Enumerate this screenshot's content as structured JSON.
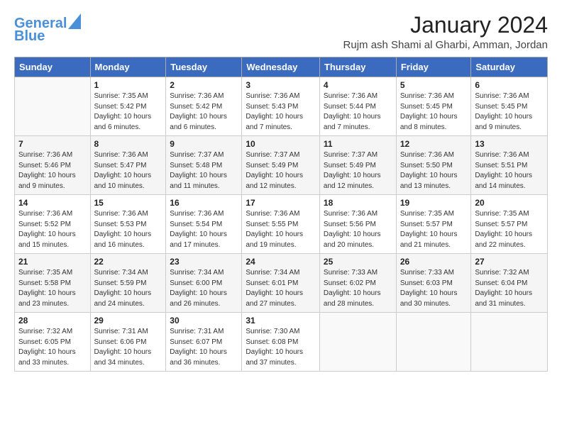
{
  "logo": {
    "line1": "General",
    "line2": "Blue"
  },
  "title": "January 2024",
  "location": "Rujm ash Shami al Gharbi, Amman, Jordan",
  "days_of_week": [
    "Sunday",
    "Monday",
    "Tuesday",
    "Wednesday",
    "Thursday",
    "Friday",
    "Saturday"
  ],
  "weeks": [
    [
      {
        "num": "",
        "info": ""
      },
      {
        "num": "1",
        "info": "Sunrise: 7:35 AM\nSunset: 5:42 PM\nDaylight: 10 hours\nand 6 minutes."
      },
      {
        "num": "2",
        "info": "Sunrise: 7:36 AM\nSunset: 5:42 PM\nDaylight: 10 hours\nand 6 minutes."
      },
      {
        "num": "3",
        "info": "Sunrise: 7:36 AM\nSunset: 5:43 PM\nDaylight: 10 hours\nand 7 minutes."
      },
      {
        "num": "4",
        "info": "Sunrise: 7:36 AM\nSunset: 5:44 PM\nDaylight: 10 hours\nand 7 minutes."
      },
      {
        "num": "5",
        "info": "Sunrise: 7:36 AM\nSunset: 5:45 PM\nDaylight: 10 hours\nand 8 minutes."
      },
      {
        "num": "6",
        "info": "Sunrise: 7:36 AM\nSunset: 5:45 PM\nDaylight: 10 hours\nand 9 minutes."
      }
    ],
    [
      {
        "num": "7",
        "info": "Sunrise: 7:36 AM\nSunset: 5:46 PM\nDaylight: 10 hours\nand 9 minutes."
      },
      {
        "num": "8",
        "info": "Sunrise: 7:36 AM\nSunset: 5:47 PM\nDaylight: 10 hours\nand 10 minutes."
      },
      {
        "num": "9",
        "info": "Sunrise: 7:37 AM\nSunset: 5:48 PM\nDaylight: 10 hours\nand 11 minutes."
      },
      {
        "num": "10",
        "info": "Sunrise: 7:37 AM\nSunset: 5:49 PM\nDaylight: 10 hours\nand 12 minutes."
      },
      {
        "num": "11",
        "info": "Sunrise: 7:37 AM\nSunset: 5:49 PM\nDaylight: 10 hours\nand 12 minutes."
      },
      {
        "num": "12",
        "info": "Sunrise: 7:36 AM\nSunset: 5:50 PM\nDaylight: 10 hours\nand 13 minutes."
      },
      {
        "num": "13",
        "info": "Sunrise: 7:36 AM\nSunset: 5:51 PM\nDaylight: 10 hours\nand 14 minutes."
      }
    ],
    [
      {
        "num": "14",
        "info": "Sunrise: 7:36 AM\nSunset: 5:52 PM\nDaylight: 10 hours\nand 15 minutes."
      },
      {
        "num": "15",
        "info": "Sunrise: 7:36 AM\nSunset: 5:53 PM\nDaylight: 10 hours\nand 16 minutes."
      },
      {
        "num": "16",
        "info": "Sunrise: 7:36 AM\nSunset: 5:54 PM\nDaylight: 10 hours\nand 17 minutes."
      },
      {
        "num": "17",
        "info": "Sunrise: 7:36 AM\nSunset: 5:55 PM\nDaylight: 10 hours\nand 19 minutes."
      },
      {
        "num": "18",
        "info": "Sunrise: 7:36 AM\nSunset: 5:56 PM\nDaylight: 10 hours\nand 20 minutes."
      },
      {
        "num": "19",
        "info": "Sunrise: 7:35 AM\nSunset: 5:57 PM\nDaylight: 10 hours\nand 21 minutes."
      },
      {
        "num": "20",
        "info": "Sunrise: 7:35 AM\nSunset: 5:57 PM\nDaylight: 10 hours\nand 22 minutes."
      }
    ],
    [
      {
        "num": "21",
        "info": "Sunrise: 7:35 AM\nSunset: 5:58 PM\nDaylight: 10 hours\nand 23 minutes."
      },
      {
        "num": "22",
        "info": "Sunrise: 7:34 AM\nSunset: 5:59 PM\nDaylight: 10 hours\nand 24 minutes."
      },
      {
        "num": "23",
        "info": "Sunrise: 7:34 AM\nSunset: 6:00 PM\nDaylight: 10 hours\nand 26 minutes."
      },
      {
        "num": "24",
        "info": "Sunrise: 7:34 AM\nSunset: 6:01 PM\nDaylight: 10 hours\nand 27 minutes."
      },
      {
        "num": "25",
        "info": "Sunrise: 7:33 AM\nSunset: 6:02 PM\nDaylight: 10 hours\nand 28 minutes."
      },
      {
        "num": "26",
        "info": "Sunrise: 7:33 AM\nSunset: 6:03 PM\nDaylight: 10 hours\nand 30 minutes."
      },
      {
        "num": "27",
        "info": "Sunrise: 7:32 AM\nSunset: 6:04 PM\nDaylight: 10 hours\nand 31 minutes."
      }
    ],
    [
      {
        "num": "28",
        "info": "Sunrise: 7:32 AM\nSunset: 6:05 PM\nDaylight: 10 hours\nand 33 minutes."
      },
      {
        "num": "29",
        "info": "Sunrise: 7:31 AM\nSunset: 6:06 PM\nDaylight: 10 hours\nand 34 minutes."
      },
      {
        "num": "30",
        "info": "Sunrise: 7:31 AM\nSunset: 6:07 PM\nDaylight: 10 hours\nand 36 minutes."
      },
      {
        "num": "31",
        "info": "Sunrise: 7:30 AM\nSunset: 6:08 PM\nDaylight: 10 hours\nand 37 minutes."
      },
      {
        "num": "",
        "info": ""
      },
      {
        "num": "",
        "info": ""
      },
      {
        "num": "",
        "info": ""
      }
    ]
  ]
}
